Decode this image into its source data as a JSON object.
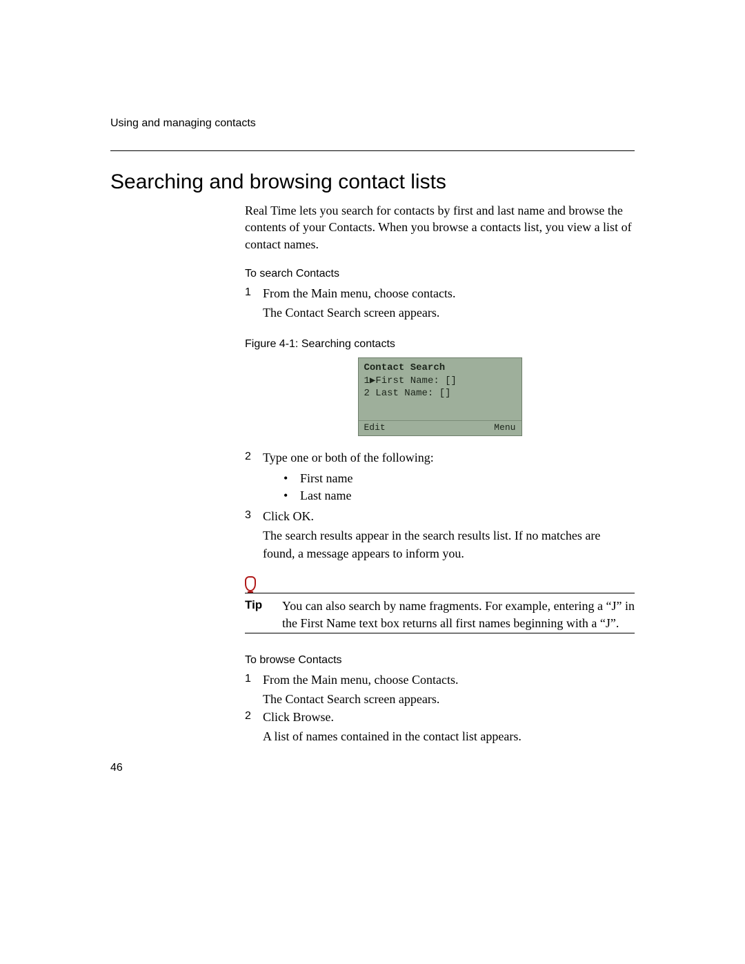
{
  "header": {
    "running": "Using and managing contacts"
  },
  "title": "Searching and browsing contact lists",
  "intro": "Real Time lets you search for contacts by first and last name and browse the contents of your Contacts. When you browse a contacts list, you view a list of contact names.",
  "search": {
    "heading": "To search Contacts",
    "steps": {
      "s1_num": "1",
      "s1_text": "From the Main menu, choose contacts.",
      "s1_cont": "The Contact Search screen appears.",
      "s2_num": "2",
      "s2_text": "Type one or both of the following:",
      "s2_bullets": {
        "b1": "First name",
        "b2": "Last name"
      },
      "s3_num": "3",
      "s3_text": "Click OK.",
      "s3_cont": "The search results appear in the search results list. If no matches are found, a message appears to inform you."
    }
  },
  "figure": {
    "caption": "Figure 4-1: Searching contacts",
    "screen": {
      "title": "Contact Search",
      "row1": "1▶First Name: []",
      "row2": "2 Last Name: []",
      "soft_left": "Edit",
      "soft_right": "Menu"
    }
  },
  "tip": {
    "label": "Tip",
    "text": "You can also search by name fragments. For example, entering a “J” in the First Name text box returns all first names beginning with a “J”."
  },
  "browse": {
    "heading": "To browse Contacts",
    "steps": {
      "s1_num": "1",
      "s1_text": "From the Main menu, choose Contacts.",
      "s1_cont": "The Contact Search screen appears.",
      "s2_num": "2",
      "s2_text": "Click Browse.",
      "s2_cont": "A list of names contained in the contact list appears."
    }
  },
  "pageNumber": "46"
}
